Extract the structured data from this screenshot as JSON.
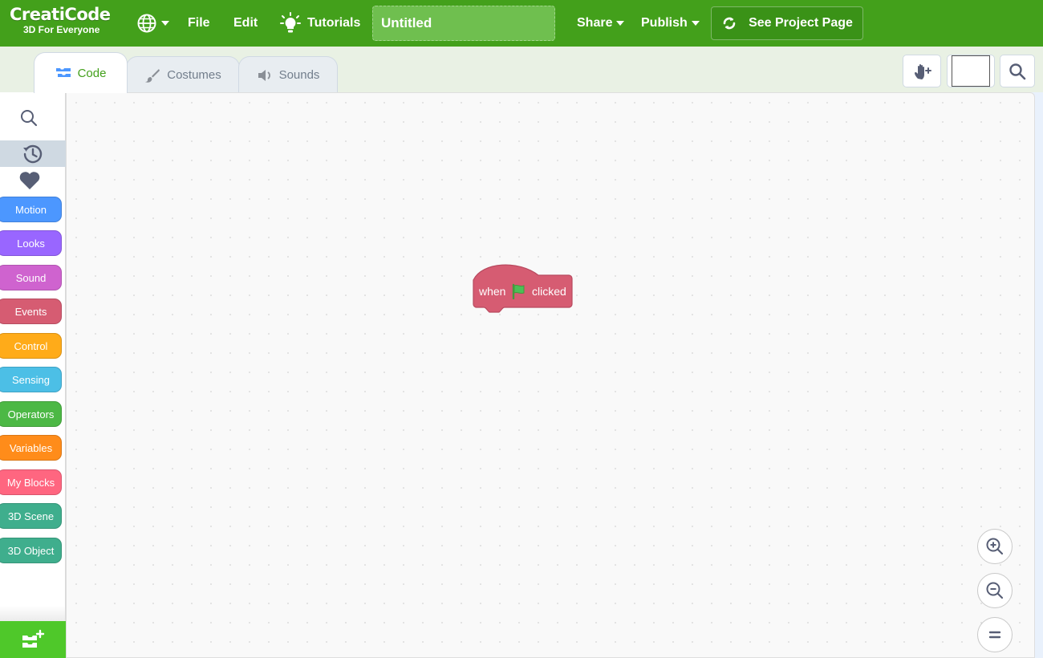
{
  "header": {
    "logo_main": "CreatiCode",
    "logo_sub": "3D For Everyone",
    "menu": {
      "file": "File",
      "edit": "Edit",
      "tutorials": "Tutorials",
      "share": "Share",
      "publish": "Publish"
    },
    "project_title": "Untitled",
    "see_project_page": "See Project Page",
    "bar_color": "#43a01b"
  },
  "tabs": [
    {
      "label": "Code",
      "active": true
    },
    {
      "label": "Costumes",
      "active": false
    },
    {
      "label": "Sounds",
      "active": false
    }
  ],
  "categories": [
    {
      "label": "Motion",
      "color": "#4c97ff"
    },
    {
      "label": "Looks",
      "color": "#9966ff"
    },
    {
      "label": "Sound",
      "color": "#cf63cf"
    },
    {
      "label": "Events",
      "color": "#d65c72"
    },
    {
      "label": "Control",
      "color": "#ffab19"
    },
    {
      "label": "Sensing",
      "color": "#4cbfe6"
    },
    {
      "label": "Operators",
      "color": "#4cb845"
    },
    {
      "label": "Variables",
      "color": "#ff8c1a"
    },
    {
      "label": "My Blocks",
      "color": "#ff6680"
    },
    {
      "label": "3D Scene",
      "color": "#3fae8d"
    },
    {
      "label": "3D Object",
      "color": "#3fae8d"
    }
  ],
  "workspace": {
    "block": {
      "text_before": "when",
      "icon": "green-flag-icon",
      "text_after": "clicked",
      "color": "#d65c72"
    }
  },
  "icons": {
    "globe": "globe-icon",
    "tutorials": "lightbulb-icon",
    "see_project": "refresh-icon",
    "code_tab": "code-blocks-icon",
    "costumes_tab": "paintbrush-icon",
    "sounds_tab": "speaker-icon",
    "hand_tool": "hand-plus-icon",
    "search": "search-icon",
    "recent": "history-icon",
    "favorites": "heart-icon",
    "extension": "add-extension-icon",
    "zoom_in": "zoom-in-icon",
    "zoom_out": "zoom-out-icon",
    "zoom_reset": "zoom-reset-icon"
  }
}
